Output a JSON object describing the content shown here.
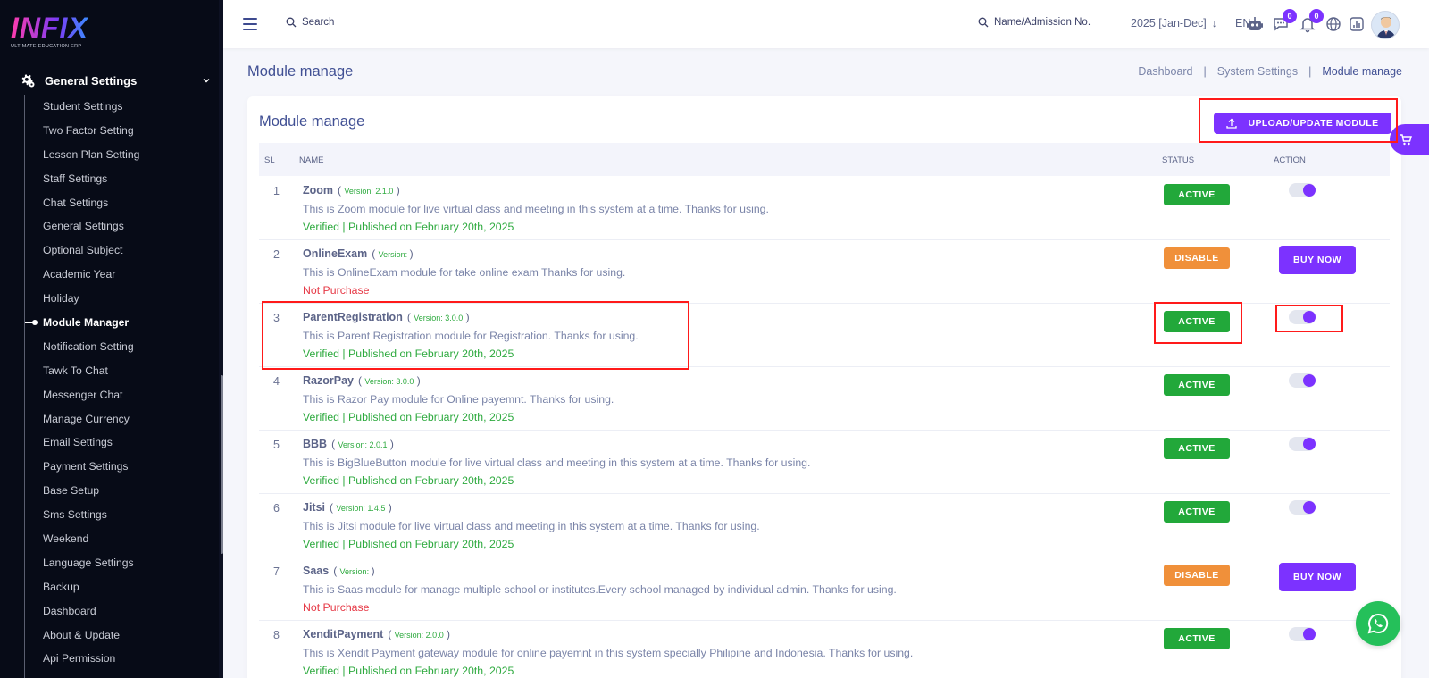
{
  "brand": {
    "logo_text": "INFIX",
    "tagline": "ULTIMATE EDUCATION ERP"
  },
  "sidebar": {
    "section_label": "General Settings",
    "items": [
      {
        "label": "Student Settings"
      },
      {
        "label": "Two Factor Setting"
      },
      {
        "label": "Lesson Plan Setting"
      },
      {
        "label": "Staff Settings"
      },
      {
        "label": "Chat Settings"
      },
      {
        "label": "General Settings"
      },
      {
        "label": "Optional Subject"
      },
      {
        "label": "Academic Year"
      },
      {
        "label": "Holiday"
      },
      {
        "label": "Module Manager",
        "active": true
      },
      {
        "label": "Notification Setting"
      },
      {
        "label": "Tawk To Chat"
      },
      {
        "label": "Messenger Chat"
      },
      {
        "label": "Manage Currency"
      },
      {
        "label": "Email Settings"
      },
      {
        "label": "Payment Settings"
      },
      {
        "label": "Base Setup"
      },
      {
        "label": "Sms Settings"
      },
      {
        "label": "Weekend"
      },
      {
        "label": "Language Settings"
      },
      {
        "label": "Backup"
      },
      {
        "label": "Dashboard"
      },
      {
        "label": "About & Update"
      },
      {
        "label": "Api Permission"
      }
    ]
  },
  "topbar": {
    "search_label": "Search",
    "student_search_label": "Name/Admission No.",
    "session": "2025 [Jan-Dec]",
    "language": "EN",
    "chat_count": "0",
    "notification_count": "0"
  },
  "page": {
    "title": "Module manage",
    "breadcrumb": [
      "Dashboard",
      "System Settings",
      "Module manage"
    ]
  },
  "card": {
    "title": "Module manage",
    "upload_button": "UPLOAD/UPDATE MODULE"
  },
  "table": {
    "headers": {
      "sl": "SL",
      "name": "NAME",
      "status": "STATUS",
      "action": "ACTION"
    },
    "rows": [
      {
        "sl": "1",
        "name": "Zoom",
        "version": "Version: 2.1.0",
        "description": "This is Zoom module for live virtual class and meeting in this system at a time. Thanks for using.",
        "meta": "Verified | Published on February 20th, 2025",
        "status": "ACTIVE",
        "action": "toggle"
      },
      {
        "sl": "2",
        "name": "OnlineExam",
        "version": "Version: ",
        "description": "This is OnlineExam module for take online exam Thanks for using.",
        "meta": "Not Purchase",
        "status": "DISABLE",
        "action": "BUY NOW"
      },
      {
        "sl": "3",
        "name": "ParentRegistration",
        "version": "Version: 3.0.0",
        "description": "This is Parent Registration module for Registration. Thanks for using.",
        "meta": "Verified | Published on February 20th, 2025",
        "status": "ACTIVE",
        "action": "toggle"
      },
      {
        "sl": "4",
        "name": "RazorPay",
        "version": "Version: 3.0.0",
        "description": "This is Razor Pay module for Online payemnt. Thanks for using.",
        "meta": "Verified | Published on February 20th, 2025",
        "status": "ACTIVE",
        "action": "toggle"
      },
      {
        "sl": "5",
        "name": "BBB",
        "version": "Version: 2.0.1",
        "description": "This is BigBlueButton module for live virtual class and meeting in this system at a time. Thanks for using.",
        "meta": "Verified | Published on February 20th, 2025",
        "status": "ACTIVE",
        "action": "toggle"
      },
      {
        "sl": "6",
        "name": "Jitsi",
        "version": "Version: 1.4.5",
        "description": "This is Jitsi module for live virtual class and meeting in this system at a time. Thanks for using.",
        "meta": "Verified | Published on February 20th, 2025",
        "status": "ACTIVE",
        "action": "toggle"
      },
      {
        "sl": "7",
        "name": "Saas",
        "version": "Version: ",
        "description": "This is Saas module for manage multiple school or institutes.Every school managed by individual admin. Thanks for using.",
        "meta": "Not Purchase",
        "status": "DISABLE",
        "action": "BUY NOW"
      },
      {
        "sl": "8",
        "name": "XenditPayment",
        "version": "Version: 2.0.0",
        "description": "This is Xendit Payment gateway module for online payemnt in this system specially Philipine and Indonesia. Thanks for using.",
        "meta": "Verified | Published on February 20th, 2025",
        "status": "ACTIVE",
        "action": "toggle"
      }
    ]
  },
  "colors": {
    "accent": "#7c32ff",
    "active": "#22a83a",
    "disable": "#f0903a",
    "verified_text": "#2eaa3f",
    "not_purchase_text": "#e63946",
    "highlight_box": "#ff1a1a"
  },
  "icons": [
    "gear-icon",
    "chevron-down-icon",
    "menu-icon",
    "search-icon",
    "robot-icon",
    "chat-icon",
    "bell-icon",
    "globe-icon",
    "chart-icon",
    "upload-icon",
    "cart-icon",
    "whatsapp-icon"
  ]
}
